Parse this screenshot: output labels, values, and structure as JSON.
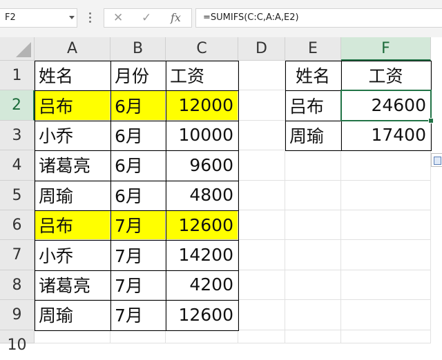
{
  "formula_bar": {
    "name_box": "F2",
    "cancel_icon": "✕",
    "enter_icon": "✓",
    "fx_icon": "fx",
    "formula": "=SUMIFS(C:C,A:A,E2)"
  },
  "grid": {
    "columns": [
      "A",
      "B",
      "C",
      "D",
      "E",
      "F"
    ],
    "rows": [
      "1",
      "2",
      "3",
      "4",
      "5",
      "6",
      "7",
      "8",
      "9",
      "10"
    ],
    "selected_cell": "F2",
    "highlight_color": "#ffff00",
    "accent_color": "#217346"
  },
  "source_table": {
    "headers": [
      "姓名",
      "月份",
      "工资"
    ],
    "rows": [
      [
        "吕布",
        "6月",
        "12000"
      ],
      [
        "小乔",
        "6月",
        "10000"
      ],
      [
        "诸葛亮",
        "6月",
        "9600"
      ],
      [
        "周瑜",
        "6月",
        "4800"
      ],
      [
        "吕布",
        "7月",
        "12600"
      ],
      [
        "小乔",
        "7月",
        "14200"
      ],
      [
        "诸葛亮",
        "7月",
        "4200"
      ],
      [
        "周瑜",
        "7月",
        "12600"
      ]
    ],
    "highlighted_rows": [
      0,
      4
    ]
  },
  "summary_table": {
    "headers": [
      "姓名",
      "工资"
    ],
    "rows": [
      [
        "吕布",
        "24600"
      ],
      [
        "周瑜",
        "17400"
      ]
    ]
  }
}
